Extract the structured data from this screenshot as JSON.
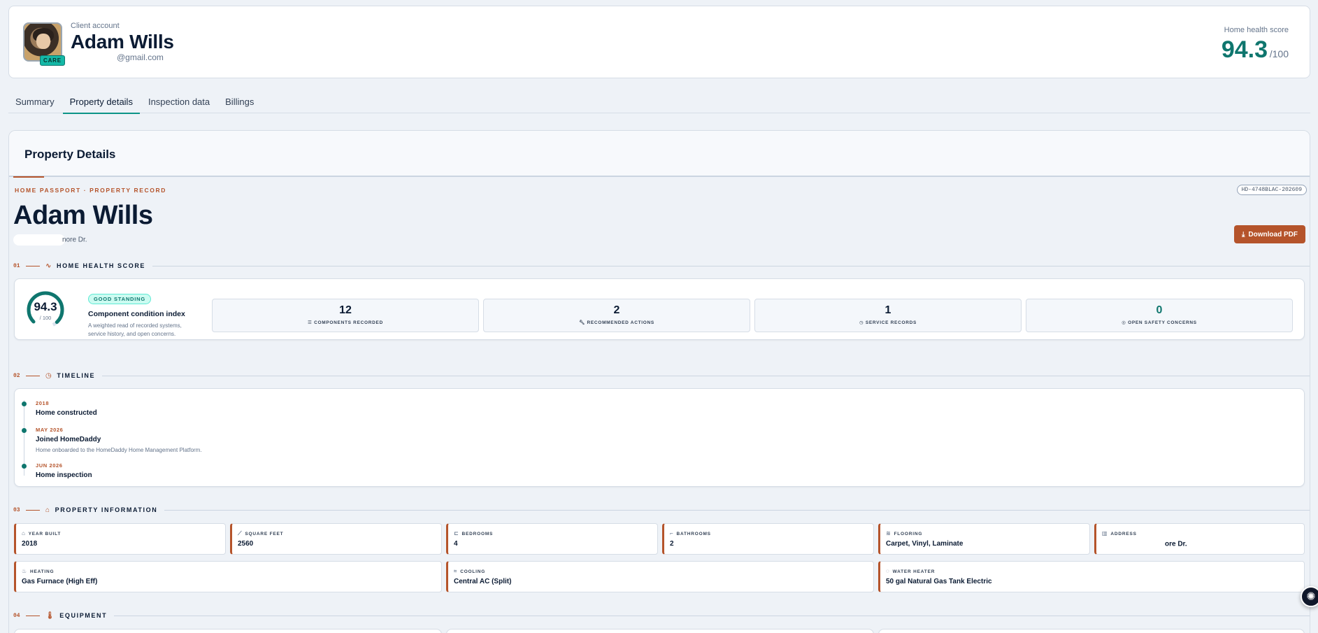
{
  "header": {
    "account_label": "Client account",
    "name": "Adam Wills",
    "email_suffix": "@gmail.com",
    "badge": "CARE",
    "health_label": "Home health score",
    "health_value": "94.3",
    "health_denom": "/100"
  },
  "tabs": [
    {
      "label": "Summary",
      "active": false
    },
    {
      "label": "Property details",
      "active": true
    },
    {
      "label": "Inspection data",
      "active": false
    },
    {
      "label": "Billings",
      "active": false
    }
  ],
  "main": {
    "title": "Property Details",
    "eyebrow": "HOME PASSPORT · PROPERTY RECORD",
    "ref_id": "HD-4748BLAC-202609",
    "owner_name": "Adam Wills",
    "address_partial": "nore Dr.",
    "download_label": "Download PDF"
  },
  "sections": {
    "health": {
      "num": "01",
      "title": "HOME HEALTH SCORE"
    },
    "timeline": {
      "num": "02",
      "title": "TIMELINE"
    },
    "property": {
      "num": "03",
      "title": "PROPERTY INFORMATION"
    },
    "equipment": {
      "num": "04",
      "title": "EQUIPMENT"
    }
  },
  "score": {
    "value": "94.3",
    "denom": "/ 100",
    "fraction": 0.943,
    "badge": "GOOD STANDING",
    "title": "Component condition index",
    "desc": "A weighted read of recorded systems, service history, and open concerns.",
    "stats": [
      {
        "value": "12",
        "label": "COMPONENTS RECORDED",
        "icon": "list-icon"
      },
      {
        "value": "2",
        "label": "RECOMMENDED ACTIONS",
        "icon": "wrench-icon"
      },
      {
        "value": "1",
        "label": "SERVICE RECORDS",
        "icon": "clock-icon"
      },
      {
        "value": "0",
        "label": "OPEN SAFETY CONCERNS",
        "icon": "shield-icon"
      }
    ]
  },
  "timeline": [
    {
      "date": "2018",
      "title": "Home constructed",
      "desc": ""
    },
    {
      "date": "MAY 2026",
      "title": "Joined HomeDaddy",
      "desc": "Home onboarded to the HomeDaddy Home Management Platform."
    },
    {
      "date": "JUN 2026",
      "title": "Home inspection",
      "desc": ""
    }
  ],
  "property_info": {
    "year_built": {
      "label": "YEAR BUILT",
      "value": "2018"
    },
    "square_feet": {
      "label": "SQUARE FEET",
      "value": "2560"
    },
    "bedrooms": {
      "label": "BEDROOMS",
      "value": "4"
    },
    "bathrooms": {
      "label": "BATHROOMS",
      "value": "2"
    },
    "flooring": {
      "label": "FLOORING",
      "value": "Carpet, Vinyl, Laminate"
    },
    "address": {
      "label": "ADDRESS",
      "value": "ore Dr."
    },
    "heating": {
      "label": "HEATING",
      "value": "Gas Furnace (High Eff)"
    },
    "cooling": {
      "label": "COOLING",
      "value": "Central AC (Split)"
    },
    "water_heater": {
      "label": "WATER HEATER",
      "value": "50 gal Natural Gas Tank Electric"
    }
  },
  "colors": {
    "accent": "#b5542b",
    "teal": "#0f766e",
    "gauge_track": "#dbe4ee"
  }
}
